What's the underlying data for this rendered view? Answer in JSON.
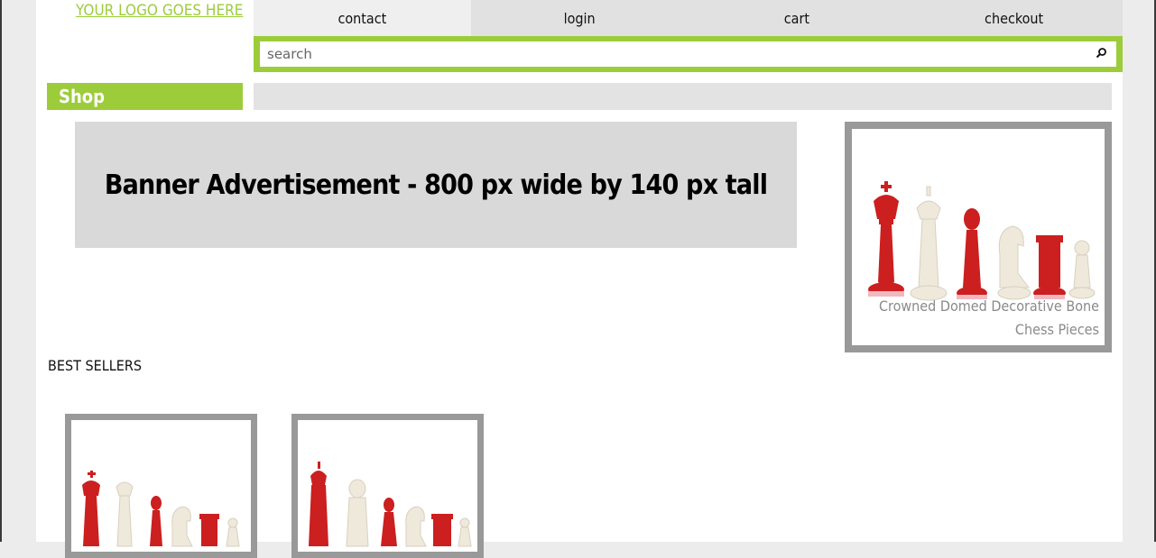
{
  "header": {
    "logo_text": "YOUR LOGO GOES HERE",
    "nav": [
      {
        "label": "contact"
      },
      {
        "label": "login"
      },
      {
        "label": "cart"
      },
      {
        "label": "checkout"
      }
    ],
    "search": {
      "placeholder": "search",
      "value": "",
      "icon": "search-icon"
    }
  },
  "shop_tab": {
    "label": "Shop"
  },
  "banner": {
    "text": "Banner Advertisement - 800 px wide by 140 px tall"
  },
  "feature": {
    "caption_line1": "Crowned Domed Decorative Bone",
    "caption_line2": "Chess Pieces"
  },
  "best_sellers": {
    "heading": "BEST SELLERS"
  },
  "colors": {
    "accent": "#9ccc3a",
    "frame": "#999999",
    "piece_red": "#cc1f1f",
    "piece_ivory": "#efe9dc"
  }
}
